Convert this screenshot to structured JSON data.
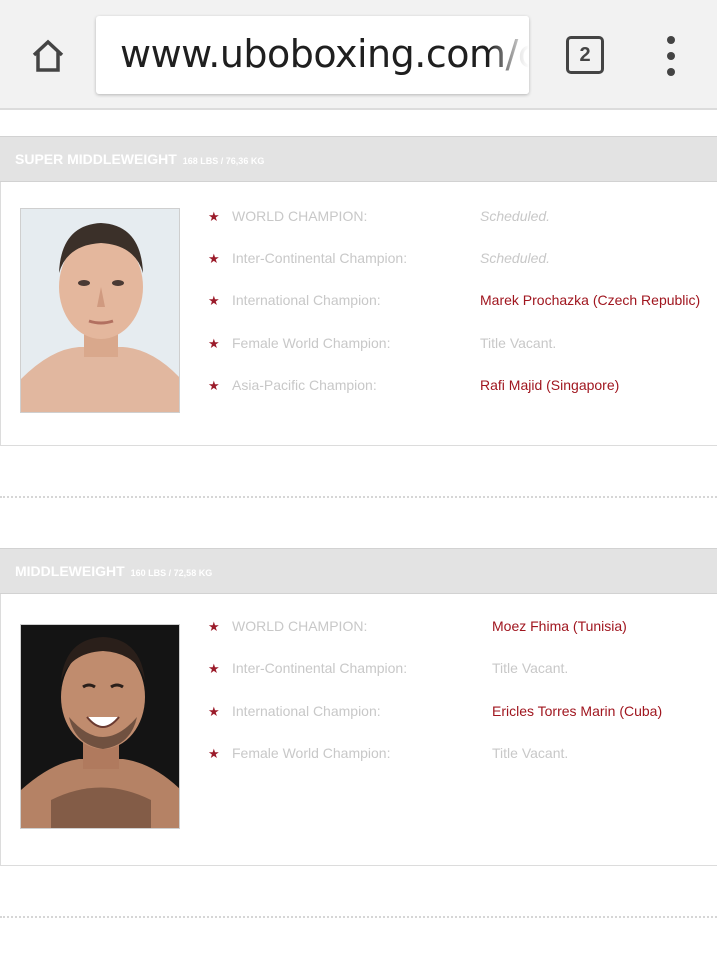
{
  "browser": {
    "url_visible": "www.uboboxing.com/",
    "url_faded": "c",
    "tab_count": "2",
    "home_icon": "home-icon",
    "menu_icon": "more-vert-icon"
  },
  "divisions": [
    {
      "title": "SUPER MIDDLEWEIGHT",
      "weight": "168 LBS / 76,36 KG",
      "titles": [
        {
          "label": "WORLD CHAMPION:",
          "value": "Scheduled.",
          "style": "italic"
        },
        {
          "label": "Inter-Continental Champion:",
          "value": "Scheduled.",
          "style": "italic"
        },
        {
          "label": "International Champion:",
          "value": "Marek Prochazka (Czech Republic)",
          "style": "name"
        },
        {
          "label": "Female World Champion:",
          "value": "Title Vacant.",
          "style": "plain"
        },
        {
          "label": "Asia-Pacific Champion:",
          "value": "Rafi Majid (Singapore)",
          "style": "name"
        }
      ]
    },
    {
      "title": "MIDDLEWEIGHT",
      "weight": "160 LBS / 72,58 KG",
      "titles": [
        {
          "label": "WORLD CHAMPION:",
          "value": "Moez Fhima (Tunisia)",
          "style": "name"
        },
        {
          "label": "Inter-Continental Champion:",
          "value": "Title Vacant.",
          "style": "plain"
        },
        {
          "label": "International Champion:",
          "value": "Ericles Torres Marin (Cuba)",
          "style": "name"
        },
        {
          "label": "Female World Champion:",
          "value": "Title Vacant.",
          "style": "plain"
        }
      ]
    }
  ],
  "colors": {
    "accent": "#9b1b2a",
    "name_text": "#a0161f",
    "muted_text": "#c8c8c8",
    "header_bg": "#e3e3e3"
  }
}
